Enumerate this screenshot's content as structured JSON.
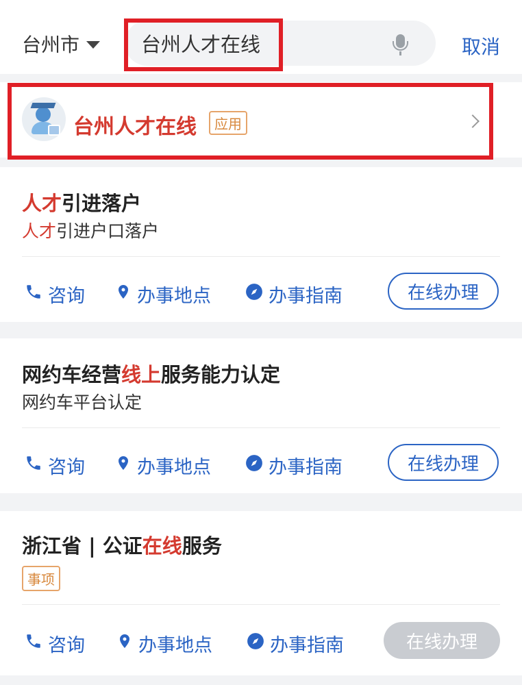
{
  "header": {
    "city": "台州市",
    "search_value": "台州人才在线",
    "cancel_label": "取消"
  },
  "app_result": {
    "name": "台州人才在线",
    "tag": "应用"
  },
  "results": [
    {
      "title_hl": "人才",
      "title_rest": "引进落户",
      "subtitle_hl": "人才",
      "subtitle_rest": "引进户口落户",
      "button": "在线办理"
    },
    {
      "title_pre": "网约车经营",
      "title_hl": "线上",
      "title_post": "服务能力认定",
      "subtitle": "网约车平台认定",
      "button": "在线办理"
    },
    {
      "title_pre": "浙江省 | 公证",
      "title_hl": "在线",
      "title_post": "服务",
      "tag": "事项",
      "button": "在线办理",
      "button_disabled": true
    }
  ],
  "actions": {
    "consult": "咨询",
    "location": "办事地点",
    "guide": "办事指南"
  },
  "colors": {
    "accent": "#2b64c4",
    "highlight": "#d43a2f",
    "annotation": "#e01f26",
    "tag": "#d8893e"
  }
}
